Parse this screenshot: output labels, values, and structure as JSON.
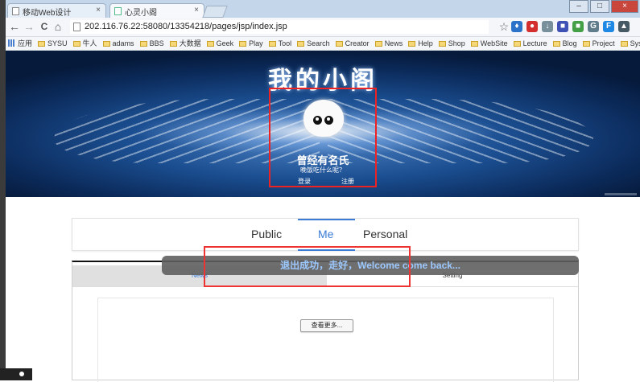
{
  "browser": {
    "tabs": [
      {
        "title": "移动Web设计",
        "close": "×"
      },
      {
        "title": "心灵小阁",
        "close": "× "
      }
    ],
    "window_controls": {
      "minimize": "–",
      "maximize": "□",
      "close": "×"
    },
    "nav": {
      "back": "←",
      "forward": "→",
      "reload": "C",
      "home": "⌂"
    },
    "url": "202.116.76.22:58080/13354218/pages/jsp/index.jsp",
    "star": "☆",
    "extensions": [
      {
        "name": "drop-icon",
        "glyph": "♦",
        "color": "#2b73c9"
      },
      {
        "name": "abp-icon",
        "glyph": "●",
        "color": "#d32f2f"
      },
      {
        "name": "download-icon",
        "glyph": "↓",
        "color": "#78909c"
      },
      {
        "name": "ext-square-icon",
        "glyph": "■",
        "color": "#3f51b5"
      },
      {
        "name": "ext-color-icon",
        "glyph": "■",
        "color": "#43a047"
      },
      {
        "name": "google-icon",
        "glyph": "G",
        "color": "#607d8b"
      },
      {
        "name": "ext-f-icon",
        "glyph": "F",
        "color": "#1e88e5"
      },
      {
        "name": "ext-tri-icon",
        "glyph": "▲",
        "color": "#455a64"
      }
    ],
    "bookmarks": [
      {
        "label": "应用",
        "type": "apps"
      },
      {
        "label": "SYSU"
      },
      {
        "label": "牛人"
      },
      {
        "label": "adams"
      },
      {
        "label": "BBS"
      },
      {
        "label": "大数据"
      },
      {
        "label": "Geek"
      },
      {
        "label": "Play"
      },
      {
        "label": "Tool"
      },
      {
        "label": "Search"
      },
      {
        "label": "Creator"
      },
      {
        "label": "News"
      },
      {
        "label": "Help"
      },
      {
        "label": "Shop"
      },
      {
        "label": "WebSite"
      },
      {
        "label": "Lecture"
      },
      {
        "label": "Blog"
      },
      {
        "label": "Project"
      },
      {
        "label": "Sysu"
      }
    ]
  },
  "banner": {
    "site_title": "我的小阁",
    "username": "曾经有名氏",
    "motto": "晚饭吃什么呢？",
    "login": "登录",
    "register": "注册"
  },
  "main_tabs": [
    {
      "label": "Public",
      "active": false
    },
    {
      "label": "Me",
      "active": true
    },
    {
      "label": "Personal",
      "active": false
    }
  ],
  "sub_tabs": [
    {
      "label": "News",
      "active": true
    },
    {
      "label": "Setting",
      "active": false
    }
  ],
  "more_button": "查看更多...",
  "toast": "退出成功，走好，Welcome come back..."
}
